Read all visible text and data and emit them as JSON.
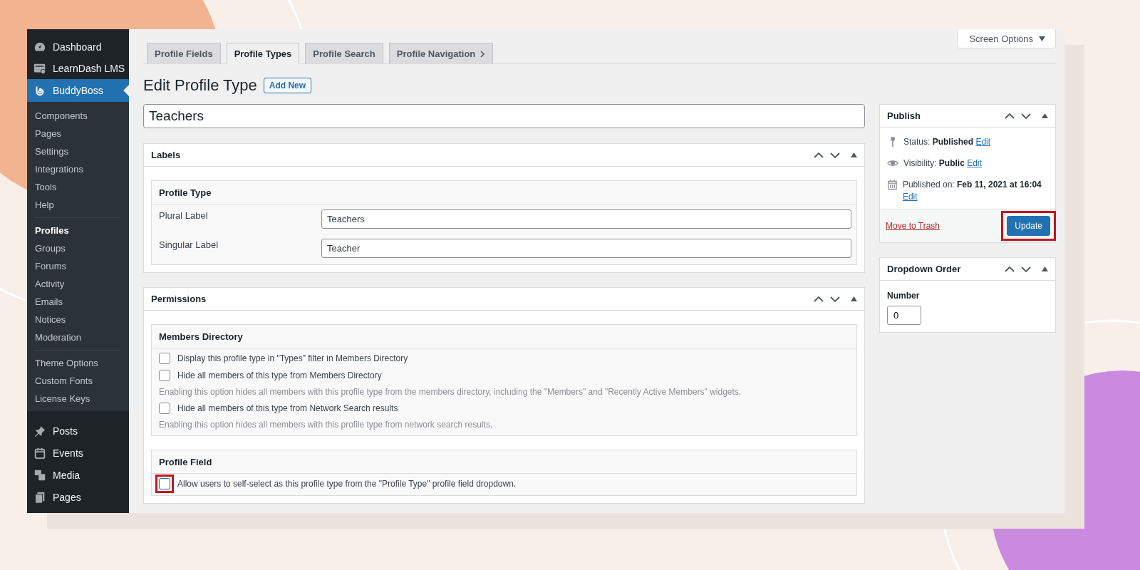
{
  "sidebar": {
    "items": [
      {
        "label": "Dashboard",
        "selected": false
      },
      {
        "label": "LearnDash LMS",
        "selected": false
      },
      {
        "label": "BuddyBoss",
        "selected": true,
        "submenu_groups": [
          {
            "items": [
              {
                "label": "Components",
                "selected": false
              },
              {
                "label": "Pages",
                "selected": false
              },
              {
                "label": "Settings",
                "selected": false
              },
              {
                "label": "Integrations",
                "selected": false
              },
              {
                "label": "Tools",
                "selected": false
              },
              {
                "label": "Help",
                "selected": false
              }
            ]
          },
          {
            "items": [
              {
                "label": "Profiles",
                "selected": true
              },
              {
                "label": "Groups",
                "selected": false
              },
              {
                "label": "Forums",
                "selected": false
              },
              {
                "label": "Activity",
                "selected": false
              },
              {
                "label": "Emails",
                "selected": false
              },
              {
                "label": "Notices",
                "selected": false
              },
              {
                "label": "Moderation",
                "selected": false
              }
            ]
          },
          {
            "items": [
              {
                "label": "Theme Options",
                "selected": false
              },
              {
                "label": "Custom Fonts",
                "selected": false
              },
              {
                "label": "License Keys",
                "selected": false
              }
            ]
          }
        ]
      },
      {
        "label": "Posts",
        "selected": false
      },
      {
        "label": "Events",
        "selected": false
      },
      {
        "label": "Media",
        "selected": false
      },
      {
        "label": "Pages",
        "selected": false
      }
    ]
  },
  "tabs": [
    {
      "label": "Profile Fields",
      "selected": false
    },
    {
      "label": "Profile Types",
      "selected": true
    },
    {
      "label": "Profile Search",
      "selected": false
    },
    {
      "label": "Profile Navigation",
      "selected": false,
      "has_arrow": true
    }
  ],
  "screen_options": "Screen Options",
  "heading": "Edit Profile Type",
  "add_new": "Add New",
  "title_value": "Teachers",
  "labels_box": {
    "title": "Labels",
    "section": "Profile Type",
    "fields": [
      {
        "label": "Plural Label",
        "value": "Teachers"
      },
      {
        "label": "Singular Label",
        "value": "Teacher"
      }
    ]
  },
  "permissions_box": {
    "title": "Permissions",
    "sections": [
      {
        "title": "Members Directory",
        "options": [
          {
            "label": "Display this profile type in \"Types\" filter in Members Directory",
            "checked": false,
            "highlighted": false
          },
          {
            "label": "Hide all members of this type from Members Directory",
            "checked": false,
            "highlighted": false,
            "description": "Enabling this option hides all members with this profile type from the members directory, including the \"Members\" and \"Recently Active Members\" widgets."
          },
          {
            "label": "Hide all members of this type from Network Search results",
            "checked": false,
            "highlighted": false,
            "description": "Enabling this option hides all members with this profile type from network search results."
          }
        ]
      },
      {
        "title": "Profile Field",
        "options": [
          {
            "label": "Allow users to self-select as this profile type from the \"Profile Type\" profile field dropdown.",
            "checked": false,
            "highlighted": true
          }
        ]
      }
    ]
  },
  "publish_box": {
    "title": "Publish",
    "rows": [
      {
        "label": "Status:",
        "value": "Published",
        "link": "Edit"
      },
      {
        "label": "Visibility:",
        "value": "Public",
        "link": "Edit"
      },
      {
        "label": "Published on:",
        "value": "Feb 11, 2021 at 16:04",
        "link": "Edit"
      }
    ],
    "trash_link": "Move to Trash",
    "update_button": {
      "label": "Update",
      "highlighted": true
    }
  },
  "dropdown_box": {
    "title": "Dropdown Order",
    "label": "Number",
    "value": "0"
  }
}
